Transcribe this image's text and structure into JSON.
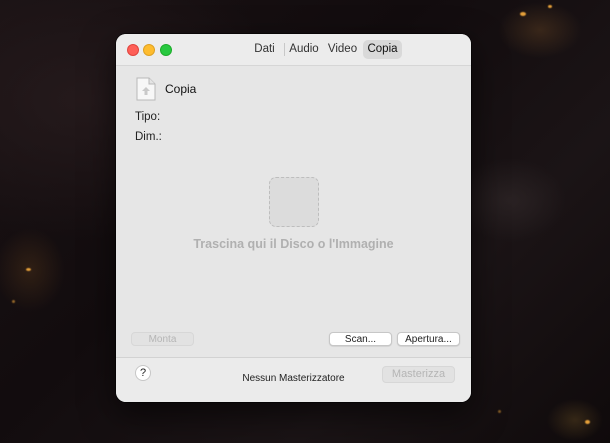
{
  "window": {
    "tabs": [
      {
        "label": "Dati",
        "active": false
      },
      {
        "label": "Audio",
        "active": false
      },
      {
        "label": "Video",
        "active": false
      },
      {
        "label": "Copia",
        "active": true
      }
    ]
  },
  "document": {
    "name": "Copia",
    "icon": "document-icon"
  },
  "info": {
    "type_label": "Tipo:",
    "size_label": "Dim.:"
  },
  "drop_area": {
    "text": "Trascina qui il Disco o l'Immagine",
    "icon": "dashed-square-icon"
  },
  "actions": {
    "mount_label": "Monta",
    "scan_label": "Scan...",
    "open_label": "Apertura..."
  },
  "footer": {
    "help_label": "?",
    "status": "Nessun Masterizzatore",
    "burn_label": "Masterizza"
  },
  "colors": {
    "close": "#fe5f57",
    "minimize": "#febc2e",
    "zoom": "#28c840",
    "window_bg": "#e6e6e6"
  }
}
